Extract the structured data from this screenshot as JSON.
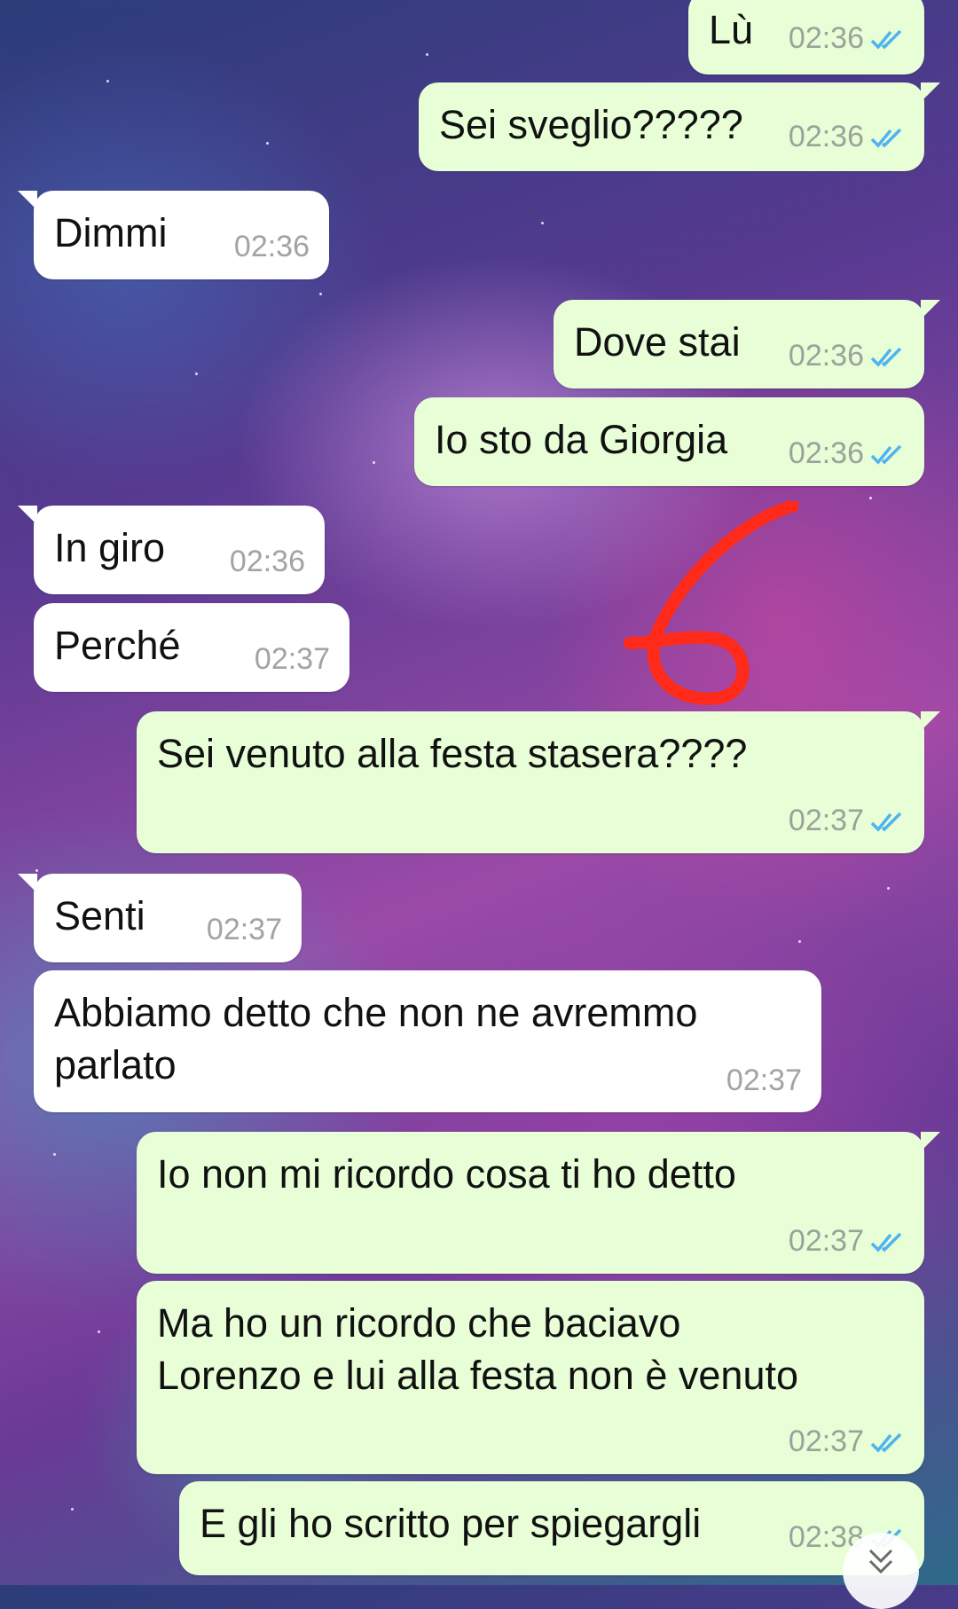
{
  "messages": [
    {
      "dir": "out",
      "text": "Lù",
      "time": "02:36"
    },
    {
      "dir": "out",
      "text": "Sei sveglio?????",
      "time": "02:36"
    },
    {
      "dir": "in",
      "text": "Dimmi",
      "time": "02:36"
    },
    {
      "dir": "out",
      "text": "Dove stai",
      "time": "02:36"
    },
    {
      "dir": "out",
      "text": "Io sto da Giorgia",
      "time": "02:36"
    },
    {
      "dir": "in",
      "text": "In giro",
      "time": "02:36"
    },
    {
      "dir": "in",
      "text": "Perché",
      "time": "02:37"
    },
    {
      "dir": "out",
      "text": "Sei venuto alla festa stasera????",
      "time": "02:37"
    },
    {
      "dir": "in",
      "text": "Senti",
      "time": "02:37"
    },
    {
      "dir": "in",
      "text": "Abbiamo detto che non ne avremmo",
      "text2": "parlato",
      "time": "02:37"
    },
    {
      "dir": "out",
      "text": "Io non mi ricordo cosa ti ho detto",
      "time": "02:37"
    },
    {
      "dir": "out",
      "text": "Ma ho un ricordo che baciavo",
      "text2": "Lorenzo e lui alla festa non è venuto",
      "time": "02:37"
    },
    {
      "dir": "out",
      "text": "E gli ho scritto per spiegargli",
      "time": "02:38"
    }
  ],
  "annotation": {
    "text": "6",
    "color": "#ff2a1a"
  },
  "colors": {
    "outgoing": "#e7fed6",
    "incoming": "#ffffff",
    "tick": "#4fb3f0"
  },
  "icons": {
    "read_receipt": "double-check-icon",
    "scroll_down": "chevron-double-down-icon"
  }
}
